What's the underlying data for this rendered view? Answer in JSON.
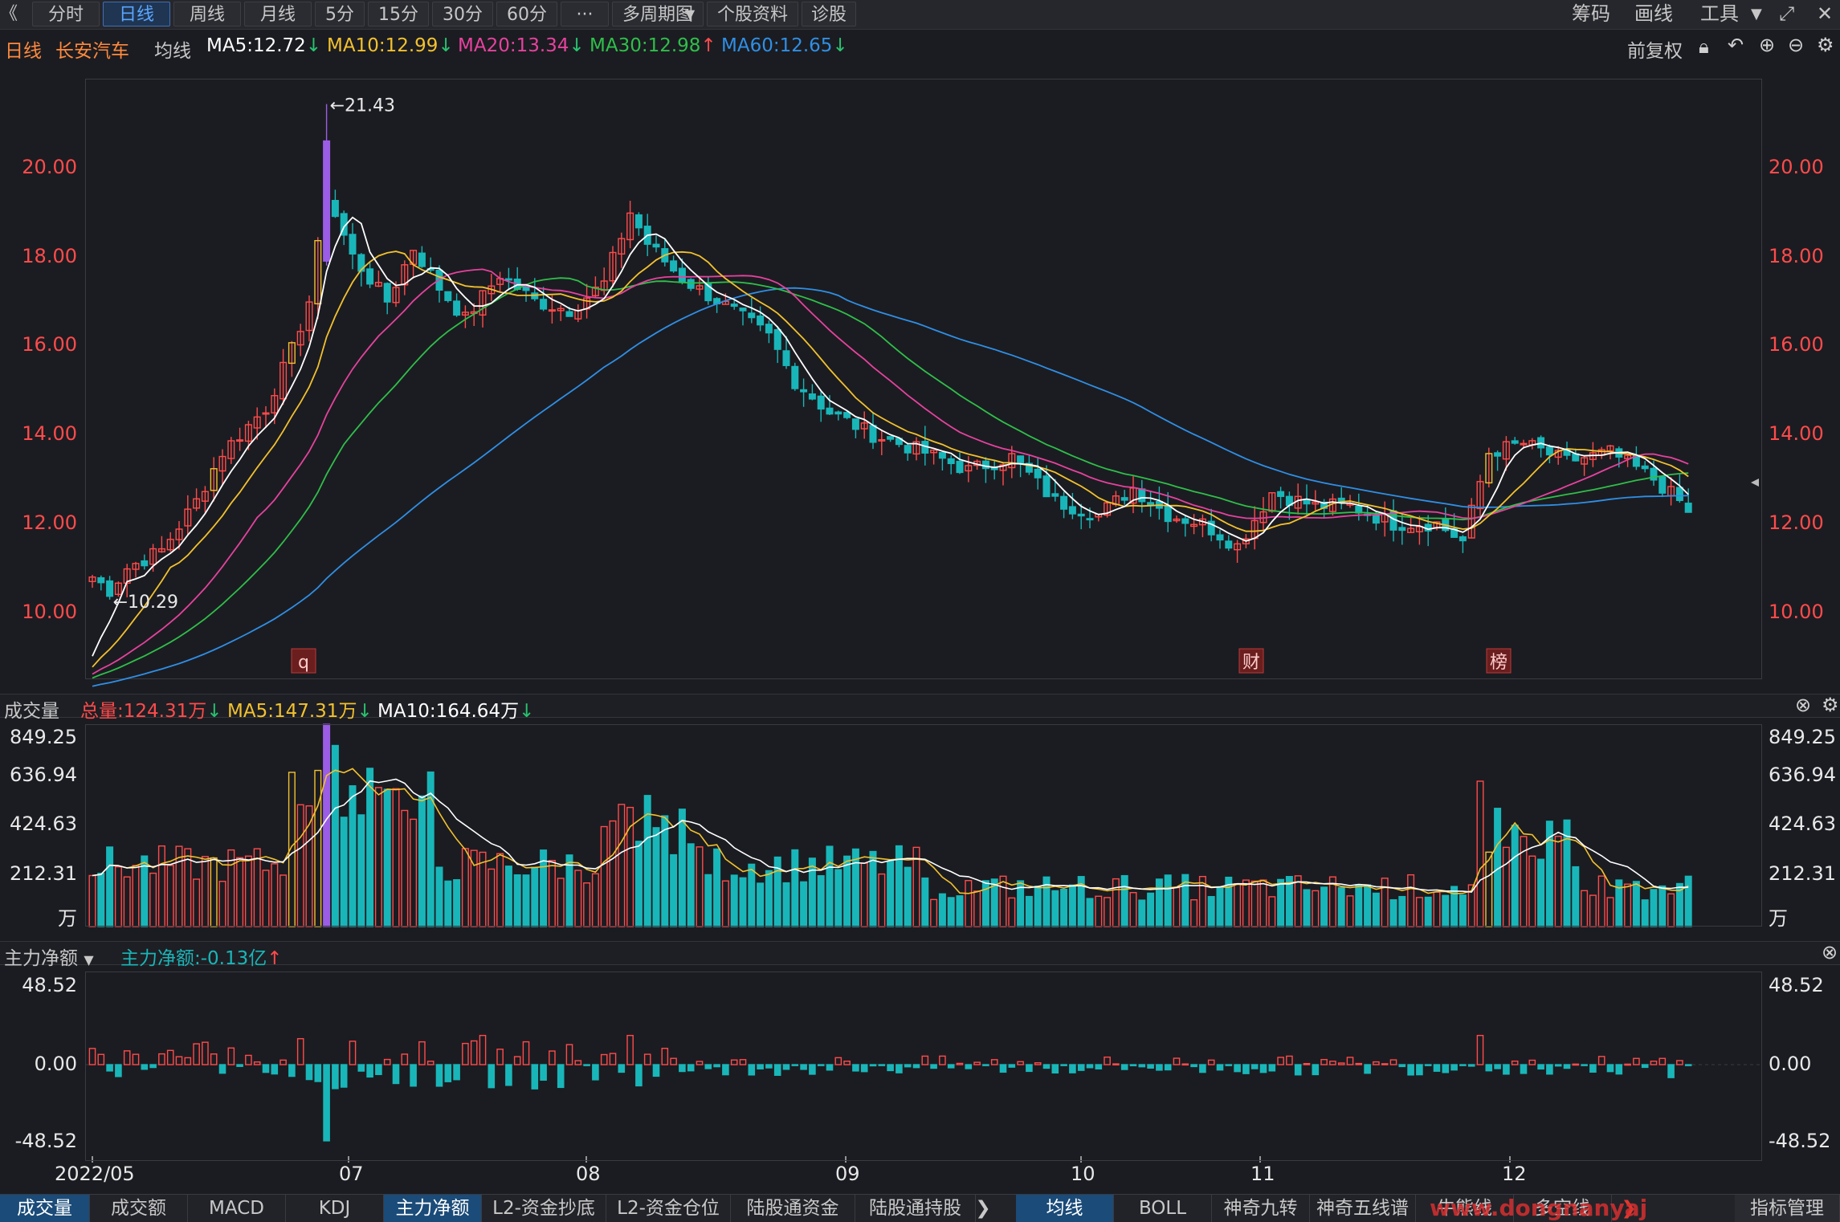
{
  "toolbar": {
    "back_icon": "《",
    "tabs": [
      {
        "label": "分时",
        "active": false
      },
      {
        "label": "日线",
        "active": true
      },
      {
        "label": "周线",
        "active": false
      },
      {
        "label": "月线",
        "active": false
      },
      {
        "label": "5分",
        "active": false
      },
      {
        "label": "15分",
        "active": false
      },
      {
        "label": "30分",
        "active": false
      },
      {
        "label": "60分",
        "active": false
      },
      {
        "label": "···",
        "active": false
      },
      {
        "label": "多周期图",
        "active": false
      },
      {
        "label": "个股资料",
        "active": false
      },
      {
        "label": "诊股",
        "active": false
      }
    ],
    "right": [
      "筹码",
      "画线",
      "工具"
    ]
  },
  "info": {
    "period": "日线",
    "stock": "长安汽车",
    "ma_label": "均线",
    "ma5": "MA5:12.72",
    "ma10": "MA10:12.99",
    "ma20": "MA20:13.34",
    "ma30": "MA30:12.98",
    "ma60": "MA60:12.65",
    "adjust": "前复权"
  },
  "colors": {
    "up": "#ff4b4b",
    "down": "#19b6b9",
    "ma5": "#ffffff",
    "ma10": "#f2c12e",
    "ma20": "#e6429e",
    "ma30": "#2fbf4a",
    "ma60": "#2f8fe6",
    "highlight": "#9b5de5"
  },
  "price_panel": {
    "y_labels": [
      "20.00",
      "18.00",
      "16.00",
      "14.00",
      "12.00",
      "10.00"
    ],
    "high_mark": "←21.43",
    "low_mark": "←10.29",
    "markers": [
      "q",
      "财",
      "榜"
    ]
  },
  "volume_panel": {
    "title": "成交量",
    "total": "总量:124.31万",
    "ma5": "MA5:147.31万",
    "ma10": "MA10:164.64万",
    "y_labels": [
      "849.25",
      "636.94",
      "424.63",
      "212.31",
      "万"
    ]
  },
  "flow_panel": {
    "title": "主力净额",
    "value": "主力净额:-0.13亿",
    "y_labels": [
      "48.52",
      "0.00",
      "-48.52"
    ]
  },
  "x_labels": [
    "2022/05",
    "07",
    "08",
    "09",
    "10",
    "11",
    "12"
  ],
  "bottom_tabs_left": [
    {
      "label": "成交量",
      "active": true
    },
    {
      "label": "成交额",
      "active": false
    },
    {
      "label": "MACD",
      "active": false
    },
    {
      "label": "KDJ",
      "active": false
    },
    {
      "label": "主力净额",
      "active": true
    },
    {
      "label": "L2-资金抄底",
      "active": false
    },
    {
      "label": "L2-资金仓位",
      "active": false
    },
    {
      "label": "陆股通资金",
      "active": false
    },
    {
      "label": "陆股通持股",
      "active": false
    }
  ],
  "bottom_tabs_right": [
    {
      "label": "均线",
      "active": true
    },
    {
      "label": "BOLL",
      "active": false
    },
    {
      "label": "神奇九转",
      "active": false
    },
    {
      "label": "神奇五线谱",
      "active": false
    },
    {
      "label": "牛熊线",
      "active": false
    },
    {
      "label": "多空线",
      "active": false
    }
  ],
  "bottom_right": "指标管理",
  "watermark": "www.dongnanyaj",
  "chart_data": {
    "type": "candlestick",
    "price_ylim": [
      8.5,
      22.0
    ],
    "price_high": 21.43,
    "price_low": 10.29,
    "price_waypoints": [
      [
        0,
        10.8
      ],
      [
        2,
        10.5
      ],
      [
        4,
        11.0
      ],
      [
        8,
        11.4
      ],
      [
        12,
        12.5
      ],
      [
        15,
        13.6
      ],
      [
        20,
        14.6
      ],
      [
        23,
        15.9
      ],
      [
        25,
        17.0
      ],
      [
        27,
        19.4
      ],
      [
        30,
        18.0
      ],
      [
        34,
        17.0
      ],
      [
        37,
        18.2
      ],
      [
        40,
        17.3
      ],
      [
        43,
        16.6
      ],
      [
        47,
        17.6
      ],
      [
        51,
        17.0
      ],
      [
        55,
        16.8
      ],
      [
        59,
        17.4
      ],
      [
        62,
        19.0
      ],
      [
        64,
        18.3
      ],
      [
        68,
        17.5
      ],
      [
        73,
        16.9
      ],
      [
        78,
        16.2
      ],
      [
        81,
        15.2
      ],
      [
        85,
        14.5
      ],
      [
        90,
        14.0
      ],
      [
        96,
        13.6
      ],
      [
        101,
        13.2
      ],
      [
        106,
        13.5
      ],
      [
        111,
        12.5
      ],
      [
        116,
        12.2
      ],
      [
        120,
        12.8
      ],
      [
        124,
        12.2
      ],
      [
        128,
        12.0
      ],
      [
        132,
        11.5
      ],
      [
        136,
        12.7
      ],
      [
        141,
        12.4
      ],
      [
        145,
        12.4
      ],
      [
        150,
        12.0
      ],
      [
        155,
        12.0
      ],
      [
        158,
        11.6
      ],
      [
        161,
        13.6
      ],
      [
        165,
        13.8
      ],
      [
        170,
        13.4
      ],
      [
        175,
        13.6
      ],
      [
        180,
        13.0
      ],
      [
        183,
        12.5
      ],
      [
        184,
        12.2
      ]
    ],
    "volume_ylim": [
      0,
      849.25
    ],
    "net_flow_ylim": [
      -48.52,
      48.52
    ]
  }
}
